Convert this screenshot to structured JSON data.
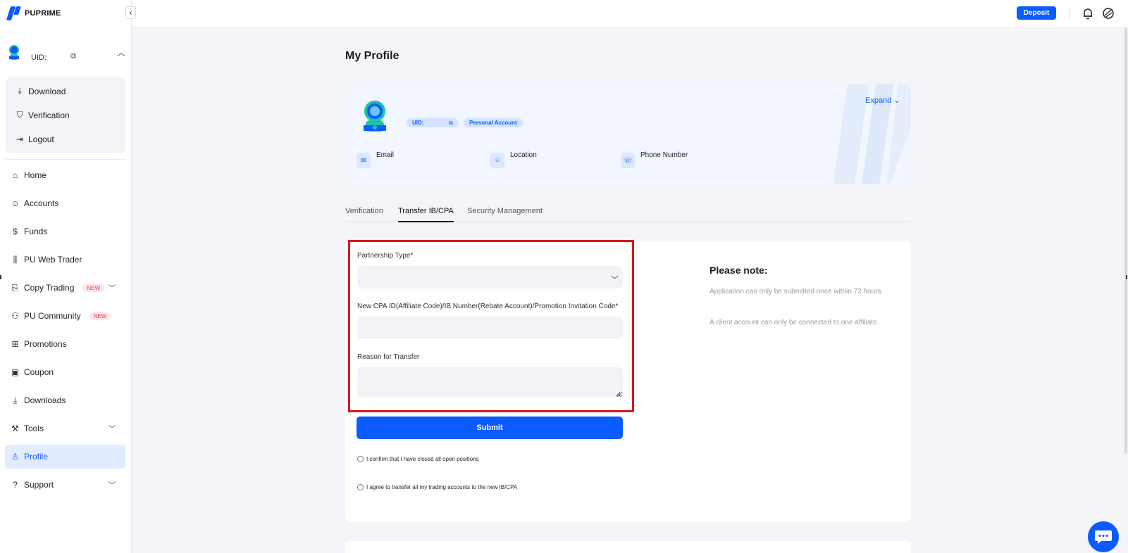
{
  "brand": {
    "name": "PUPRIME",
    "accent": "#0b5cff"
  },
  "sidebar": {
    "collapse_icon": "chevron-left-icon",
    "user": {
      "uid_label": "UID:",
      "copy_icon": "copy-icon",
      "caret_icon": "chevron-up-icon"
    },
    "user_menu": [
      {
        "label": "Download",
        "icon": "download-icon"
      },
      {
        "label": "Verification",
        "icon": "shield-check-icon"
      },
      {
        "label": "Logout",
        "icon": "logout-icon"
      }
    ],
    "nav": [
      {
        "label": "Home",
        "icon": "home-icon"
      },
      {
        "label": "Accounts",
        "icon": "user-circle-icon"
      },
      {
        "label": "Funds",
        "icon": "dollar-circle-icon"
      },
      {
        "label": "PU Web Trader",
        "icon": "candlestick-icon"
      },
      {
        "label": "Copy Trading",
        "icon": "copy-trading-icon",
        "badge": "NEW",
        "expandable": true
      },
      {
        "label": "PU Community",
        "icon": "community-icon",
        "badge": "NEW"
      },
      {
        "label": "Promotions",
        "icon": "gift-icon"
      },
      {
        "label": "Coupon",
        "icon": "coupon-icon"
      },
      {
        "label": "Downloads",
        "icon": "download-icon"
      },
      {
        "label": "Tools",
        "icon": "wrench-icon",
        "expandable": true
      },
      {
        "label": "Profile",
        "icon": "person-icon",
        "active": true
      },
      {
        "label": "Support",
        "icon": "question-circle-icon",
        "expandable": true
      }
    ]
  },
  "topbar": {
    "deposit_label": "Deposit",
    "icons": [
      "bell-icon",
      "language-icon"
    ]
  },
  "page": {
    "title": "My Profile"
  },
  "profile_card": {
    "expand_label": "Expand",
    "uid_label": "UID:",
    "account_type": "Personal Account",
    "email_label": "Email",
    "location_label": "Location",
    "phone_label": "Phone Number"
  },
  "tabs": [
    {
      "label": "Verification",
      "active": false
    },
    {
      "label": "Transfer IB/CPA",
      "active": true
    },
    {
      "label": "Security Management",
      "active": false
    }
  ],
  "form": {
    "partnership_label": "Partnership Type*",
    "partnership_value": "",
    "code_label": "New CPA ID(Affiliate Code)/IB Number(Rebate Account)/Promotion Invitation Code*",
    "code_value": "",
    "reason_label": "Reason for Transfer",
    "reason_value": "",
    "submit_label": "Submit",
    "confirm_positions": "I confirm that I have closed all open positions",
    "agree_transfer": "I agree to transfer all my trading accounts to the new IB/CPA"
  },
  "note": {
    "title": "Please note:",
    "line1": "Application can only be submitted once within 72 hours.",
    "line2": "A client account can only be connected to one affiliate."
  },
  "colors": {
    "highlight": "#d6181f",
    "badge": "#ef3e4a",
    "muted": "#9a9ca3"
  }
}
